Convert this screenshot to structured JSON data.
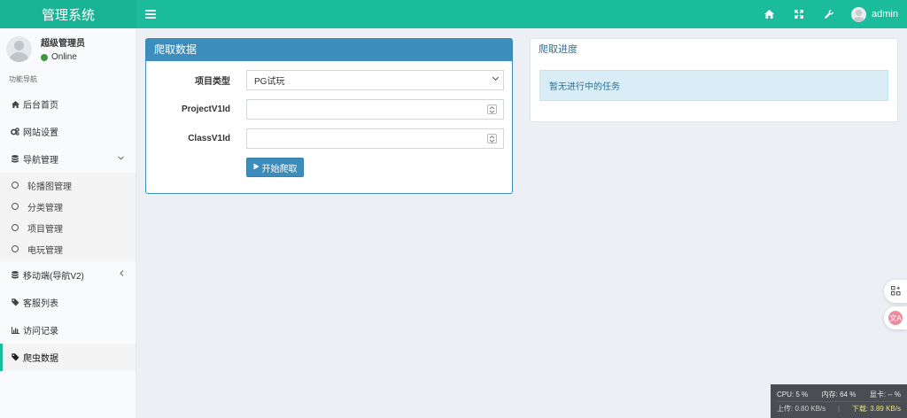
{
  "topbar": {
    "brand": "管理系统",
    "user_name": "admin",
    "icons": [
      "home-icon",
      "fullscreen-icon",
      "wrench-icon"
    ]
  },
  "sidebar": {
    "user_title": "超级管理员",
    "status": "Online",
    "nav_header": "功能导航",
    "items": [
      {
        "label": "后台首页",
        "icon": "home-icon"
      },
      {
        "label": "网站设置",
        "icon": "cogs-icon"
      },
      {
        "label": "导航管理",
        "icon": "database-icon"
      },
      {
        "label": "移动端(导航V2)",
        "icon": "database-icon"
      },
      {
        "label": "客服列表",
        "icon": "tags-icon"
      },
      {
        "label": "访问记录",
        "icon": "bar-chart-icon"
      },
      {
        "label": "爬虫数据",
        "icon": "tags-icon"
      }
    ],
    "sub_items": [
      {
        "label": "轮播图管理"
      },
      {
        "label": "分类管理"
      },
      {
        "label": "项目管理"
      },
      {
        "label": "电玩管理"
      }
    ]
  },
  "crawl_box": {
    "title": "爬取数据",
    "project_type_label": "项目类型",
    "project_type_value": "PG试玩",
    "project_v1_label": "ProjectV1Id",
    "project_v1_value": "",
    "class_v1_label": "ClassV1Id",
    "class_v1_value": "",
    "start_button": "开始爬取"
  },
  "progress_box": {
    "title": "爬取进度",
    "message": "暂无进行中的任务"
  },
  "float": {
    "translate_label": "文A"
  },
  "stats": {
    "cpu": "CPU: 5 %",
    "mem": "内存: 64 %",
    "gpu": "显卡: -- %",
    "upload": "上传: 0.80 KB/s",
    "download": "下载: 3.89 KB/s"
  }
}
